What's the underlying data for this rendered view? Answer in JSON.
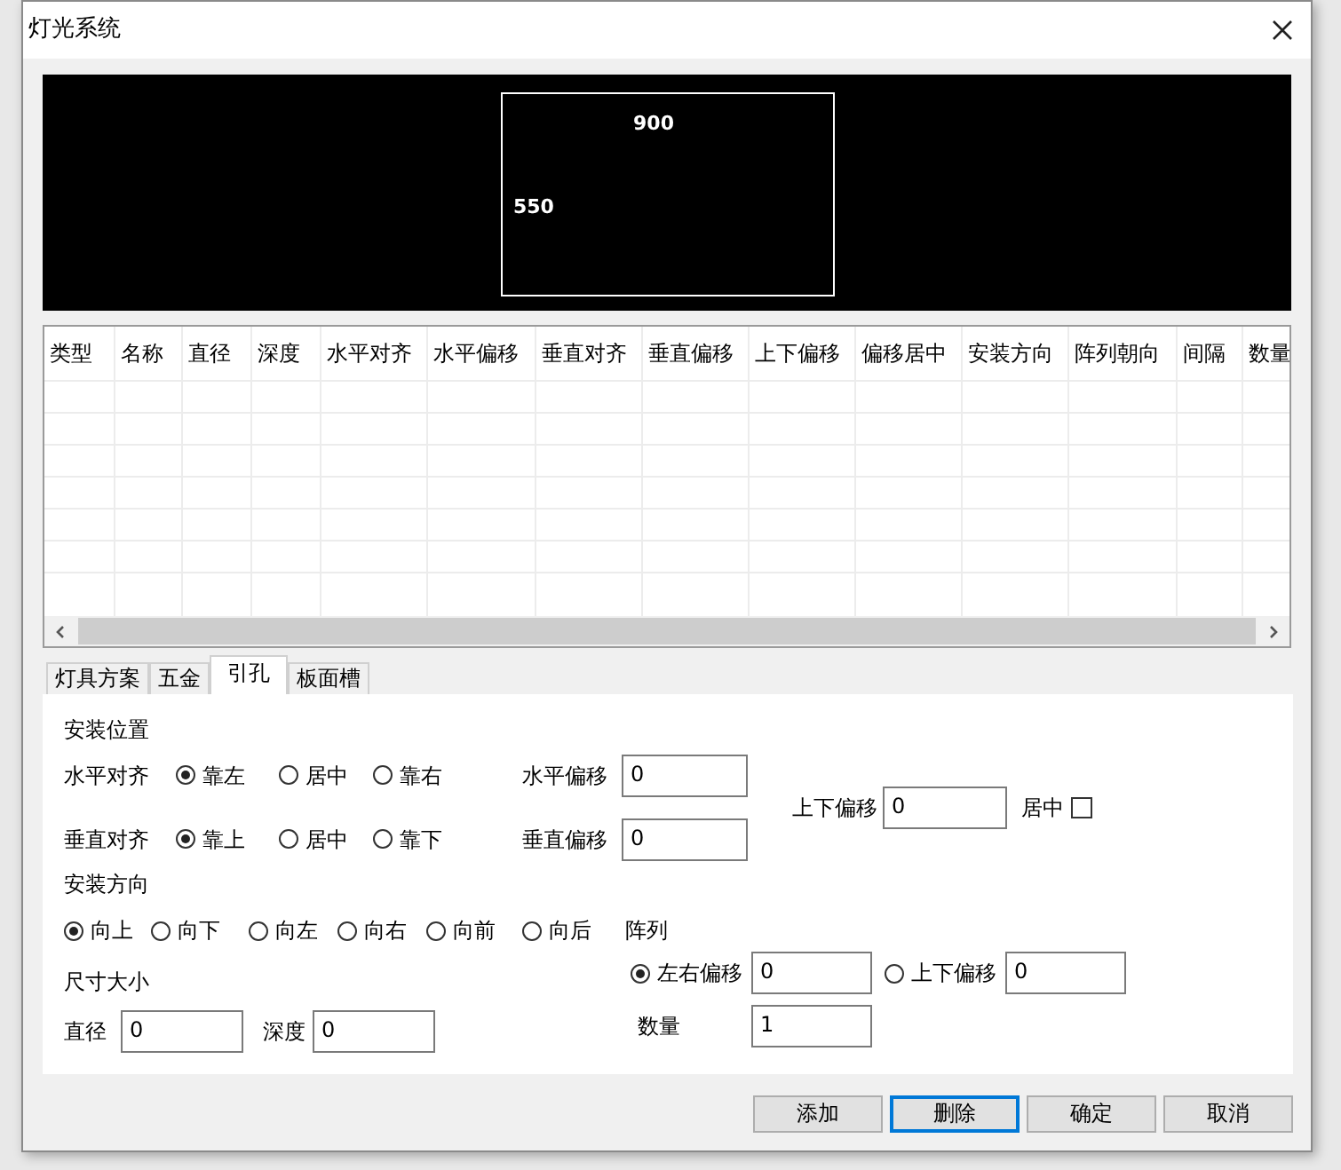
{
  "window": {
    "title": "灯光系统"
  },
  "preview": {
    "width_label": "900",
    "height_label": "550"
  },
  "table": {
    "columns": [
      "类型",
      "名称",
      "直径",
      "深度",
      "水平对齐",
      "水平偏移",
      "垂直对齐",
      "垂直偏移",
      "上下偏移",
      "偏移居中",
      "安装方向",
      "阵列朝向",
      "间隔",
      "数量"
    ]
  },
  "tabs": [
    {
      "label": "灯具方案",
      "selected": false
    },
    {
      "label": "五金",
      "selected": false
    },
    {
      "label": "引孔",
      "selected": true
    },
    {
      "label": "板面槽",
      "selected": false
    }
  ],
  "form": {
    "position_title": "安装位置",
    "align_rows": [
      {
        "label": "水平对齐",
        "options": [
          {
            "label": "靠左",
            "selected": true
          },
          {
            "label": "居中",
            "selected": false
          },
          {
            "label": "靠右",
            "selected": false
          }
        ],
        "offset_label": "水平偏移",
        "offset_value": "0"
      },
      {
        "label": "垂直对齐",
        "options": [
          {
            "label": "靠上",
            "selected": true
          },
          {
            "label": "居中",
            "selected": false
          },
          {
            "label": "靠下",
            "selected": false
          }
        ],
        "offset_label": "垂直偏移",
        "offset_value": "0"
      }
    ],
    "updown": {
      "label": "上下偏移",
      "value": "0"
    },
    "center": {
      "label": "居中",
      "checked": false
    },
    "direction_title": "安装方向",
    "directions": [
      {
        "label": "向上",
        "selected": true
      },
      {
        "label": "向下",
        "selected": false
      },
      {
        "label": "向左",
        "selected": false
      },
      {
        "label": "向右",
        "selected": false
      },
      {
        "label": "向前",
        "selected": false
      },
      {
        "label": "向后",
        "selected": false
      }
    ],
    "array_label": "阵列",
    "size_title": "尺寸大小",
    "size_fields": [
      {
        "label": "直径",
        "value": "0"
      },
      {
        "label": "深度",
        "value": "0"
      }
    ],
    "array_modes": [
      {
        "label": "左右偏移",
        "selected": true,
        "value": "0"
      },
      {
        "label": "上下偏移",
        "selected": false,
        "value": "0"
      }
    ],
    "count": {
      "label": "数量",
      "value": "1"
    }
  },
  "buttons": [
    {
      "label": "添加",
      "focused": false
    },
    {
      "label": "删除",
      "focused": true
    },
    {
      "label": "确定",
      "focused": false
    },
    {
      "label": "取消",
      "focused": false
    }
  ]
}
